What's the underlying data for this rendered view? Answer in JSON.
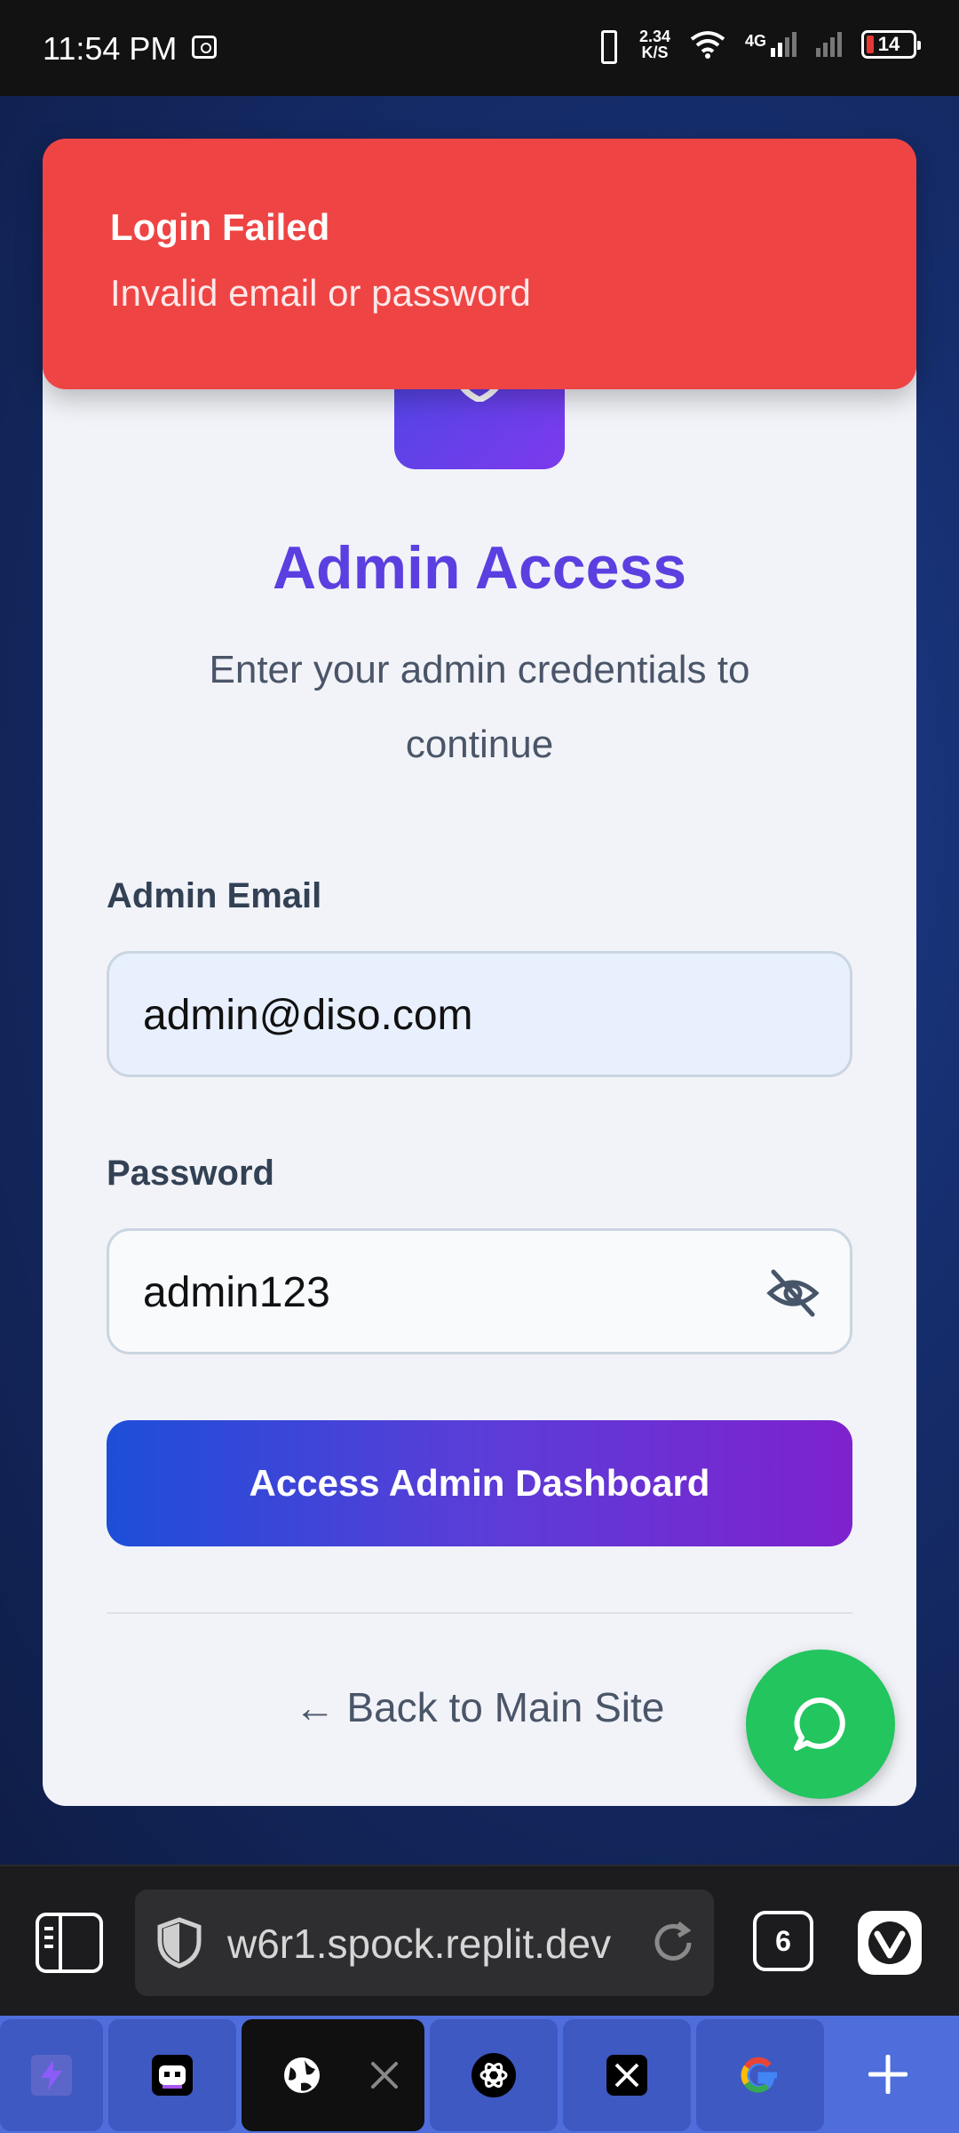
{
  "status_bar": {
    "time": "11:54 PM",
    "net_speed_value": "2.34",
    "net_speed_unit": "K/S",
    "network_type": "4G",
    "battery_level": "14"
  },
  "toast": {
    "title": "Login Failed",
    "message": "Invalid email or password",
    "color": "#ef4444"
  },
  "login": {
    "title": "Admin Access",
    "subtitle": "Enter your admin credentials to continue",
    "email_label": "Admin Email",
    "email_value": "admin@diso.com",
    "password_label": "Password",
    "password_value": "admin123",
    "submit_label": "Access Admin Dashboard",
    "back_link": "← Back to Main Site"
  },
  "browser": {
    "url": "w6r1.spock.replit.dev",
    "tab_count": "6"
  },
  "tab_strip": {
    "tabs": [
      "bolt-icon",
      "robot-icon",
      "globe-icon",
      "openai-icon",
      "x-icon",
      "google-icon"
    ],
    "active_index": 2
  },
  "colors": {
    "accent_start": "#1d4ed8",
    "accent_end": "#7e22ce",
    "chat_fab": "#22c55e"
  }
}
